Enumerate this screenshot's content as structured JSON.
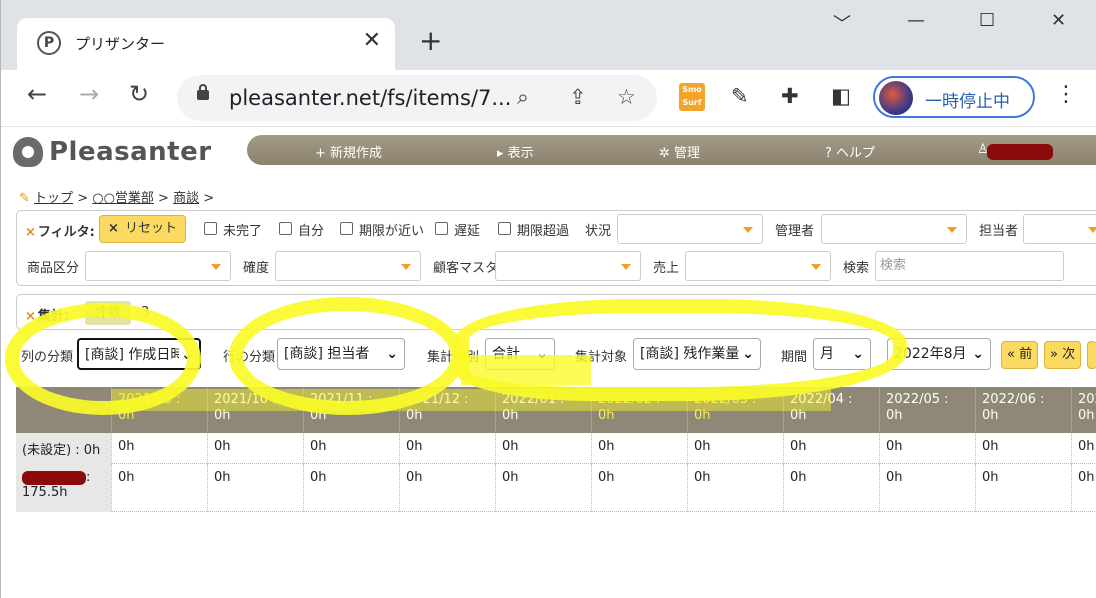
{
  "browser": {
    "tab_title": "プリザンター",
    "tab_close": "✕",
    "new_tab": "+",
    "window_controls": [
      "﹀",
      "—",
      "☐",
      "✕"
    ],
    "url": "pleasanter.net/fs/items/7...",
    "profile_label": "一時停止中",
    "extension_smo": "Smo Surf"
  },
  "app": {
    "logo": "Pleasanter",
    "menu": [
      "+ 新規作成",
      "▸ 表示",
      "✲ 管理",
      "? ヘルプ"
    ],
    "breadcrumb": [
      "トップ",
      "○○営業部",
      "商談"
    ],
    "filter": {
      "title": "フィルタ:",
      "reset": "リセット",
      "checks": [
        "未完了",
        "自分",
        "期限が近い",
        "遅延",
        "期限超過"
      ],
      "labels": {
        "status": "状況",
        "manager": "管理者",
        "owner": "担当者",
        "class": "商品区分",
        "certainty": "確度",
        "customer": "顧客マスタ",
        "sales": "売上",
        "search": "検索"
      },
      "search_placeholder": "検索"
    },
    "aggregation": {
      "title": "集計:",
      "pill": "件数",
      "count": "3"
    },
    "crosstab": {
      "col_label": "列の分類",
      "col_value": "[商談] 作成日時",
      "row_label": "行の分類",
      "row_value": "[商談] 担当者",
      "agg_type_label": "集計種別",
      "agg_type_value": "合計",
      "agg_target_label": "集計対象",
      "agg_target_value": "[商談] 残作業量",
      "period_label": "期間",
      "period_value": "月",
      "month_value": "2022年8月",
      "prev": "« 前",
      "next": "» 次"
    },
    "table": {
      "headers": [
        [
          "2021/09 :",
          "0h"
        ],
        [
          "2021/10 :",
          "0h"
        ],
        [
          "2021/11 :",
          "0h"
        ],
        [
          "2021/12 :",
          "0h"
        ],
        [
          "2022/01 :",
          "0h"
        ],
        [
          "2022/02 :",
          "0h"
        ],
        [
          "2022/03 :",
          "0h"
        ],
        [
          "2022/04 :",
          "0h"
        ],
        [
          "2022/05 :",
          "0h"
        ],
        [
          "2022/06 :",
          "0h"
        ],
        [
          "2022",
          "0h"
        ]
      ],
      "rows": [
        {
          "label": "(未設定) : 0h",
          "values": [
            "0h",
            "0h",
            "0h",
            "0h",
            "0h",
            "0h",
            "0h",
            "0h",
            "0h",
            "0h",
            "0h"
          ]
        },
        {
          "label_suffix": ":",
          "label_total": "175.5h",
          "values": [
            "0h",
            "0h",
            "0h",
            "0h",
            "0h",
            "0h",
            "0h",
            "0h",
            "0h",
            "0h",
            "0h"
          ]
        }
      ]
    }
  }
}
